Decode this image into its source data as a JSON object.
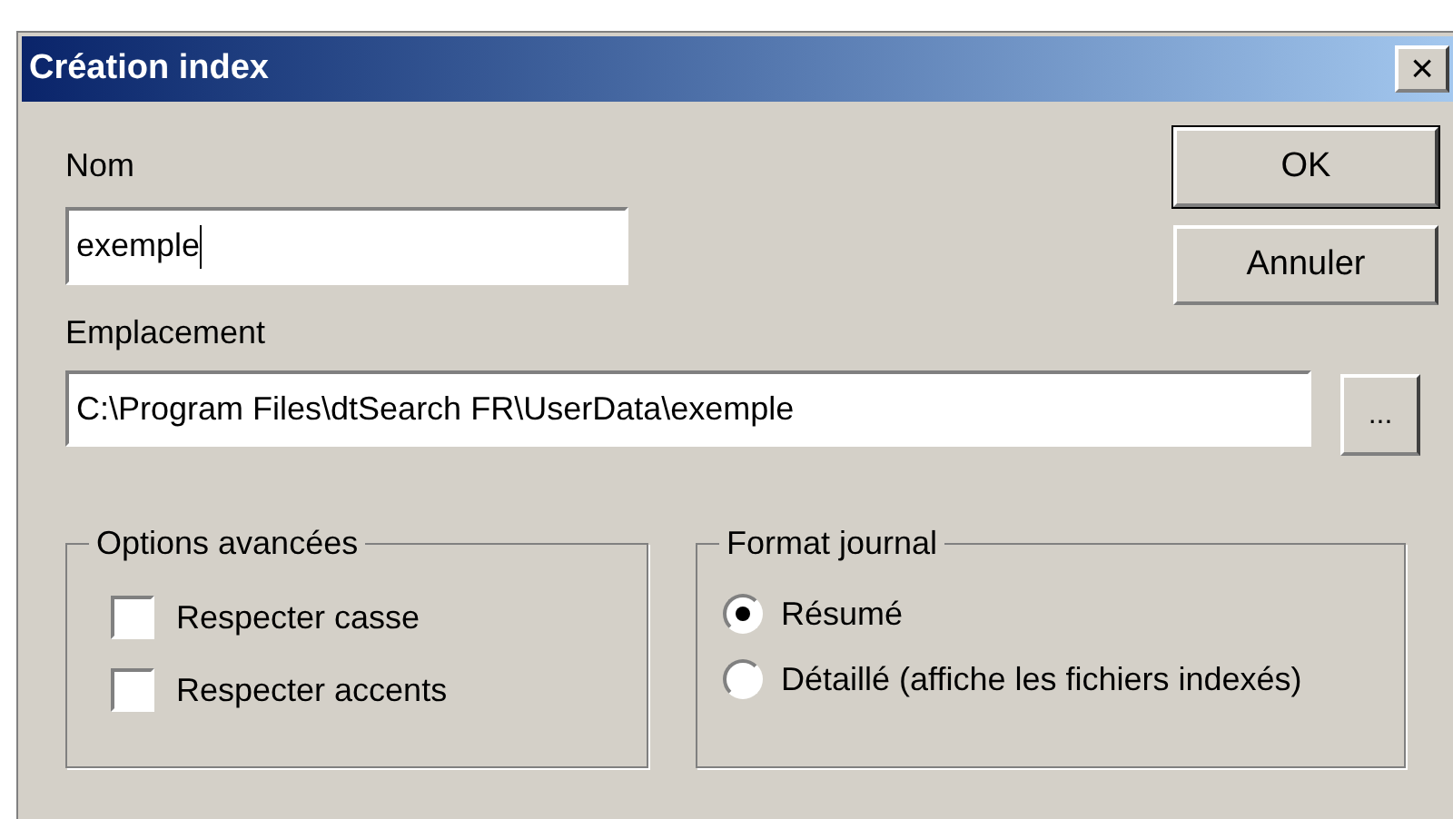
{
  "window": {
    "title": "Création index",
    "close": "×"
  },
  "name_field": {
    "label": "Nom",
    "value": "exemple"
  },
  "location_field": {
    "label": "Emplacement",
    "value": "C:\\Program Files\\dtSearch FR\\UserData\\exemple",
    "browse": "..."
  },
  "buttons": [
    {
      "label": "OK",
      "default": true
    },
    {
      "label": "Annuler",
      "default": false
    }
  ],
  "advanced_options": {
    "title": "Options avancées",
    "items": [
      {
        "label": "Respecter casse",
        "checked": false
      },
      {
        "label": "Respecter accents",
        "checked": false
      }
    ]
  },
  "log_format": {
    "title": "Format journal",
    "items": [
      {
        "label": "Résumé",
        "selected": true
      },
      {
        "label": "Détaillé (affiche les fichiers indexés)",
        "selected": false
      }
    ]
  }
}
